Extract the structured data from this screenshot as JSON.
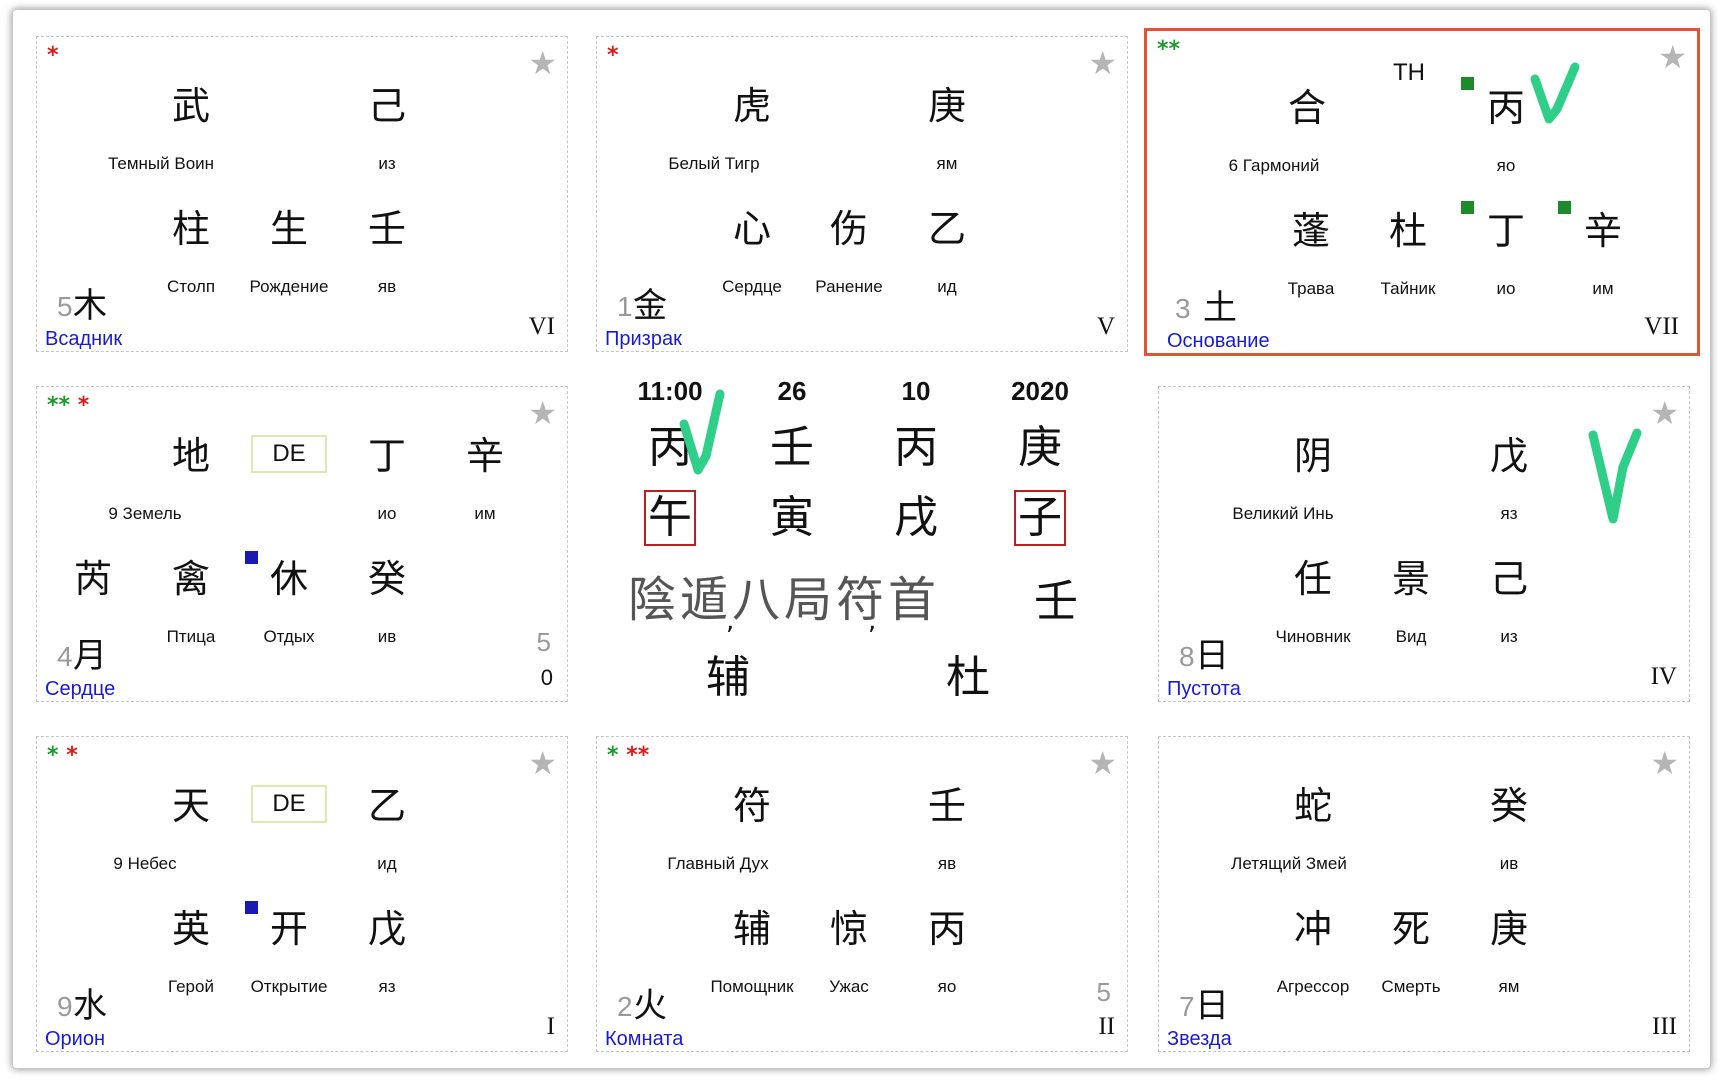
{
  "colors": {
    "highlight": "#e0553a",
    "star": "#b5b5b5",
    "check": "#2fcf8a",
    "title_blue": "#1a1ad6"
  },
  "center": {
    "time": "11:00",
    "day": "26",
    "month": "10",
    "year": "2020",
    "stems": [
      "丙",
      "壬",
      "丙",
      "庚"
    ],
    "branches": [
      "午",
      "寅",
      "戌",
      "子"
    ],
    "line1": "陰遁八局符首",
    "line1_end": "壬",
    "bottom_left": "辅",
    "bottom_right": "杜"
  },
  "palaces": {
    "vi": {
      "marks_green": "",
      "marks_red": "*",
      "star": "★",
      "top_left": "武",
      "top_left_label": "Темный Воин",
      "top_right": "己",
      "top_right_label": "из",
      "bot1": "柱",
      "bot1_label": "Столп",
      "bot2": "生",
      "bot2_label": "Рождение",
      "bot3": "壬",
      "bot3_label": "яв",
      "num": "5",
      "element": "木",
      "title": "Всадник",
      "roman": "VI"
    },
    "v": {
      "marks_green": "",
      "marks_red": "*",
      "star": "★",
      "top_left": "虎",
      "top_left_label": "Белый Тигр",
      "top_right": "庚",
      "top_right_label": "ям",
      "bot1": "心",
      "bot1_label": "Сердце",
      "bot2": "伤",
      "bot2_label": "Ранение",
      "bot3": "乙",
      "bot3_label": "ид",
      "num": "1",
      "element": "金",
      "title": "Призрак",
      "roman": "V"
    },
    "vii": {
      "marks_green": "**",
      "marks_red": "",
      "star": "★",
      "th": "TH",
      "top_left": "合",
      "top_left_label": "6 Гармоний",
      "top_right": "丙",
      "top_right_label": "яо",
      "bot1": "蓬",
      "bot1_label": "Трава",
      "bot2": "杜",
      "bot2_label": "Тайник",
      "bot3": "丁",
      "bot3_label": "ио",
      "bot4": "辛",
      "bot4_label": "им",
      "num": "3",
      "element": "土",
      "title": "Основание",
      "roman": "VII"
    },
    "left": {
      "marks_green": "**",
      "marks_red": "*",
      "star": "★",
      "de": "DE",
      "top_left": "地",
      "top_left_label": "9 Земель",
      "top_right": "丁",
      "top_right_label": "ио",
      "top_right2": "辛",
      "top_right2_label": "им",
      "bot0": "芮",
      "bot1": "禽",
      "bot1_label": "Птица",
      "bot2": "休",
      "bot2_label": "Отдых",
      "bot3": "癸",
      "bot3_label": "ив",
      "num": "4",
      "element": "月",
      "title": "Сердце",
      "right_num": "5",
      "right_sub": "0"
    },
    "iv": {
      "marks_green": "",
      "marks_red": "",
      "star": "★",
      "top_left": "阴",
      "top_left_label": "Великий Инь",
      "top_right": "戊",
      "top_right_label": "яз",
      "bot1": "任",
      "bot1_label": "Чиновник",
      "bot2": "景",
      "bot2_label": "Вид",
      "bot3": "己",
      "bot3_label": "из",
      "num": "8",
      "element": "日",
      "title": "Пустота",
      "roman": "IV"
    },
    "i": {
      "marks_green": "*",
      "marks_red": "*",
      "star": "★",
      "de": "DE",
      "top_left": "天",
      "top_left_label": "9 Небес",
      "top_right": "乙",
      "top_right_label": "ид",
      "bot1": "英",
      "bot1_label": "Герой",
      "bot2": "开",
      "bot2_label": "Открытие",
      "bot3": "戊",
      "bot3_label": "яз",
      "num": "9",
      "element": "水",
      "title": "Орион",
      "roman": "I"
    },
    "ii": {
      "marks_green": "*",
      "marks_red": "**",
      "star": "★",
      "top_left": "符",
      "top_left_label": "Главный Дух",
      "top_right": "壬",
      "top_right_label": "яв",
      "bot1": "辅",
      "bot1_label": "Помощник",
      "bot2": "惊",
      "bot2_label": "Ужас",
      "bot3": "丙",
      "bot3_label": "яо",
      "num": "2",
      "element": "火",
      "title": "Комната",
      "right_num": "5",
      "roman": "II"
    },
    "iii": {
      "marks_green": "",
      "marks_red": "",
      "star": "★",
      "top_left": "蛇",
      "top_left_label": "Летящий Змей",
      "top_right": "癸",
      "top_right_label": "ив",
      "bot1": "冲",
      "bot1_label": "Агрессор",
      "bot2": "死",
      "bot2_label": "Смерть",
      "bot3": "庚",
      "bot3_label": "ям",
      "num": "7",
      "element": "日",
      "title": "Звезда",
      "roman": "III"
    }
  }
}
